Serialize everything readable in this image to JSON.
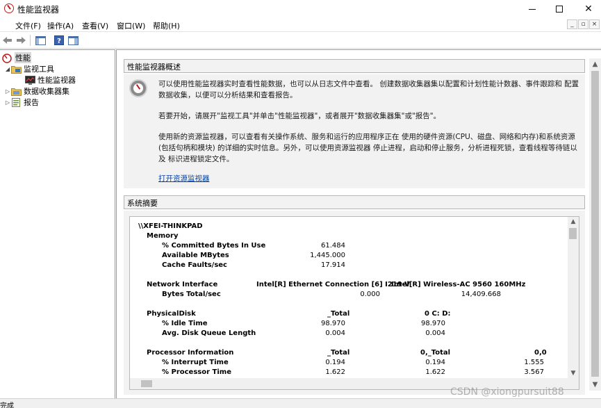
{
  "window": {
    "title": "性能监视器",
    "controls": {
      "minimize": "–",
      "maximize": "□",
      "close": "✕"
    }
  },
  "menu": {
    "items": [
      "文件(F)",
      "操作(A)",
      "查看(V)",
      "窗口(W)",
      "帮助(H)"
    ],
    "mdi_buttons": [
      "_",
      "▫",
      "×"
    ]
  },
  "toolbar": {
    "icons": [
      "back-arrow-icon",
      "forward-arrow-icon",
      "show-hide-console-tree-icon",
      "help-icon",
      "show-action-pane-icon"
    ]
  },
  "tree": {
    "root": "性能",
    "items": [
      {
        "label": "监视工具",
        "expanded": true,
        "icon": "folder-monitor-icon"
      },
      {
        "label": "性能监视器",
        "child": true,
        "icon": "performance-monitor-icon"
      },
      {
        "label": "数据收集器集",
        "expanded": false,
        "icon": "data-collector-icon"
      },
      {
        "label": "报告",
        "expanded": false,
        "icon": "report-icon"
      }
    ]
  },
  "overview": {
    "heading": "性能监视器概述",
    "para1": "可以使用性能监视器实时查看性能数据，也可以从日志文件中查看。 创建数据收集器集以配置和计划性能计数器、事件跟踪和 配置数据收集，以便可以分析结果和查看报告。",
    "para2": "若要开始，请展开\"监视工具\"并单击\"性能监视器\"，或者展开\"数据收集器集\"或\"报告\"。",
    "para3": "使用新的资源监视器，可以查看有关操作系统、服务和运行的应用程序正在 使用的硬件资源(CPU、磁盘、网络和内存)和系统资源(包括句柄和模块) 的详细的实时信息。另外，可以使用资源监视器 停止进程，启动和停止服务，分析进程死锁，查看线程等待链以及 标识进程锁定文件。",
    "link": "打开资源监视器"
  },
  "summary": {
    "heading": "系统摘要",
    "machine": "\\\\XFEI-THINKPAD",
    "memory": {
      "label": "Memory",
      "rows": [
        {
          "name": "% Committed Bytes In Use",
          "value": "61.484"
        },
        {
          "name": "Available MBytes",
          "value": "1,445.000"
        },
        {
          "name": "Cache Faults/sec",
          "value": "17.914"
        }
      ]
    },
    "network": {
      "label": "Network Interface",
      "col1": "Intel[R] Ethernet Connection [6] I219-V",
      "col2": "Intel[R] Wireless-AC 9560 160MHz",
      "row": {
        "name": "Bytes Total/sec",
        "v1": "0.000",
        "v2": "14,409.668"
      }
    },
    "disk": {
      "label": "PhysicalDisk",
      "col1": "_Total",
      "col2": "0 C: D:",
      "rows": [
        {
          "name": "% Idle Time",
          "v1": "98.970",
          "v2": "98.970"
        },
        {
          "name": "Avg. Disk Queue Length",
          "v1": "0.004",
          "v2": "0.004"
        }
      ]
    },
    "processor": {
      "label": "Processor Information",
      "col1": "_Total",
      "col2": "0,_Total",
      "col3": "0,0",
      "rows": [
        {
          "name": "% Interrupt Time",
          "v1": "0.194",
          "v2": "0.194",
          "v3": "1.555"
        },
        {
          "name": "% Processor Time",
          "v1": "1.622",
          "v2": "1.622",
          "v3": "3.567"
        }
      ]
    }
  },
  "status": {
    "text": "完成"
  },
  "watermark": "CSDN @xiongpursuit88",
  "colors": {
    "link": "#0645ad",
    "panel": "#f2f2f2",
    "accent_red": "#c01818"
  }
}
